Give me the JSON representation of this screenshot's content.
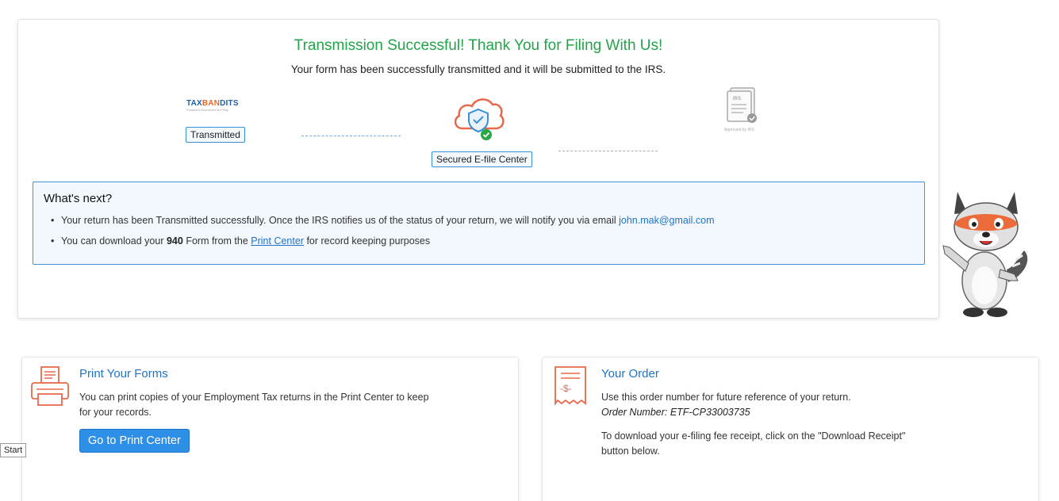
{
  "header": {
    "title": "Transmission Successful! Thank You for Filing With Us!",
    "subtitle": "Your form has been successfully transmitted and it will be submitted to the IRS."
  },
  "steps": {
    "logo_left": "TAX",
    "logo_mid": "BAN",
    "logo_right": "DITS",
    "logo_tagline": "Powered & Empowered Tax Filing",
    "transmitted": "Transmitted",
    "secured": "Secured E-file Center",
    "irs_doc": "IRS",
    "approved": "Approved by IRS"
  },
  "next": {
    "title": "What's next?",
    "line1_text": "Your return has been Transmitted successfully. Once the IRS notifies us of the status of your return, we will notify you via email ",
    "line1_email": "john.mak@gmail.com",
    "line2_prefix": "You can download your ",
    "line2_form": "940",
    "line2_mid": " Form from the ",
    "line2_link": "Print Center",
    "line2_suffix": " for record keeping purposes"
  },
  "print_card": {
    "title": "Print Your Forms",
    "text_line1": "You can print copies of your Employment Tax returns in the Print Center to keep",
    "text_line2": "for your records.",
    "button": "Go to Print Center"
  },
  "order_card": {
    "title": "Your Order",
    "text": "Use this order number for future reference of your return.",
    "order_number": "Order Number: ETF-CP33003735",
    "receipt_line1": "To download your e-filing fee receipt, click on the \"Download Receipt\"",
    "receipt_line2": "button below.",
    "receipt_icon_symbol": "-$-"
  },
  "misc": {
    "start_label": "Start"
  },
  "colors": {
    "success_green": "#22a34a",
    "link_blue": "#1e73c8",
    "accent_orange": "#e8694a",
    "button_blue": "#2e8fe6"
  }
}
